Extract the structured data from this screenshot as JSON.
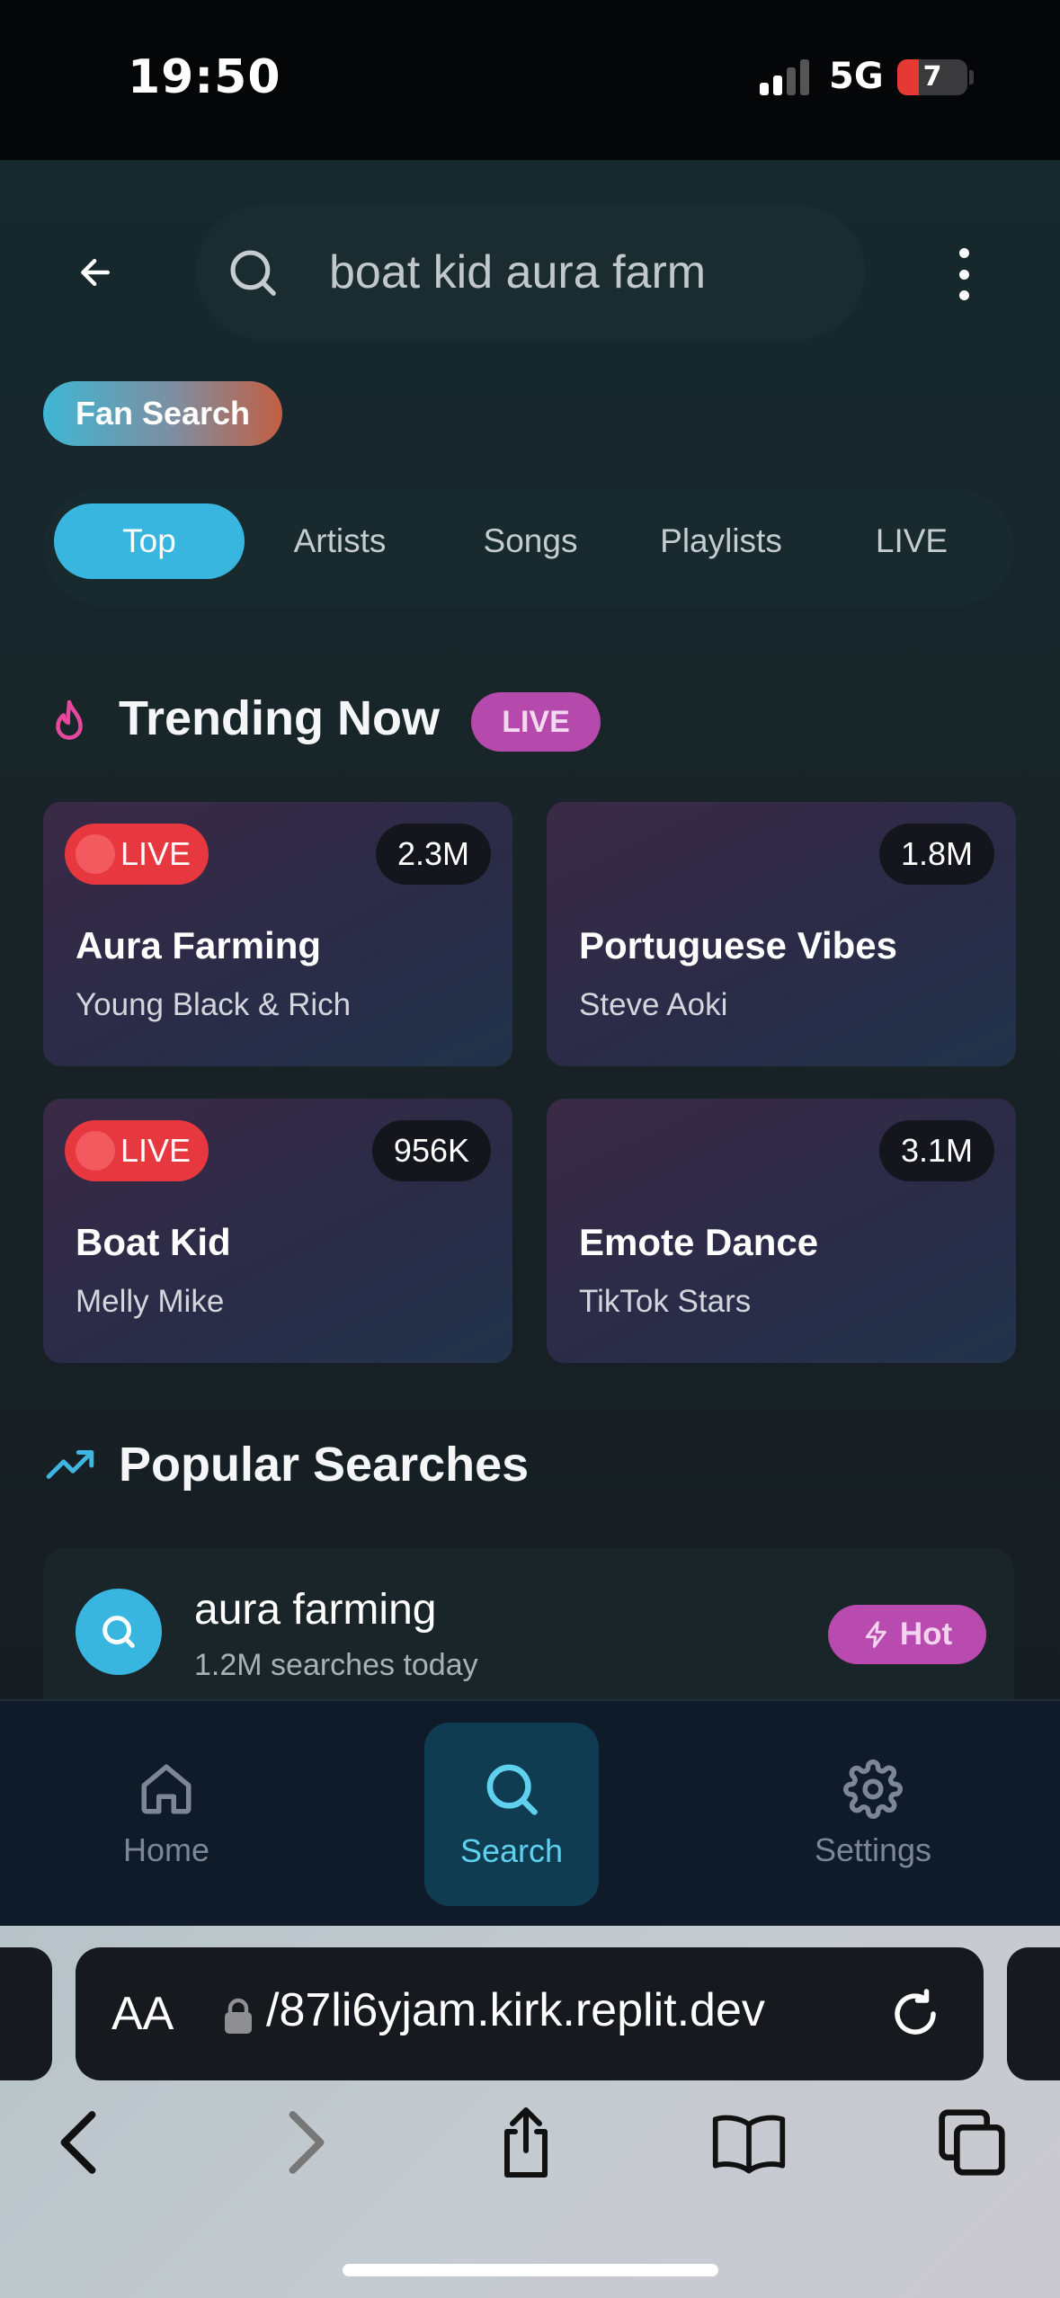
{
  "status_bar": {
    "time": "19:50",
    "network": "5G",
    "battery": "7"
  },
  "header": {
    "search_value": "boat kid aura farm"
  },
  "fan_chip": "Fan Search",
  "tabs": [
    {
      "label": "Top",
      "active": true
    },
    {
      "label": "Artists"
    },
    {
      "label": "Songs"
    },
    {
      "label": "Playlists"
    },
    {
      "label": "LIVE"
    }
  ],
  "trending": {
    "title": "Trending Now",
    "badge": "LIVE",
    "cards": [
      {
        "title": "Aura Farming",
        "artist": "Young Black & Rich",
        "count": "2.3M",
        "live": "LIVE"
      },
      {
        "title": "Portuguese Vibes",
        "artist": "Steve Aoki",
        "count": "1.8M"
      },
      {
        "title": "Boat Kid",
        "artist": "Melly Mike",
        "count": "956K",
        "live": "LIVE"
      },
      {
        "title": "Emote Dance",
        "artist": "TikTok Stars",
        "count": "3.1M"
      }
    ]
  },
  "popular": {
    "title": "Popular Searches",
    "items": [
      {
        "query": "aura farming",
        "meta": "1.2M searches today",
        "badge": "Hot"
      }
    ]
  },
  "bottom_nav": [
    {
      "label": "Home",
      "icon": "home-icon"
    },
    {
      "label": "Search",
      "icon": "search-icon",
      "active": true
    },
    {
      "label": "Settings",
      "icon": "gear-icon"
    }
  ],
  "browser": {
    "aa_label": "AA",
    "url": "/87li6yjam.kirk.replit.dev"
  },
  "colors": {
    "accent": "#38b6e0",
    "live_red": "#e8383f",
    "magenta": "#b54aac"
  }
}
